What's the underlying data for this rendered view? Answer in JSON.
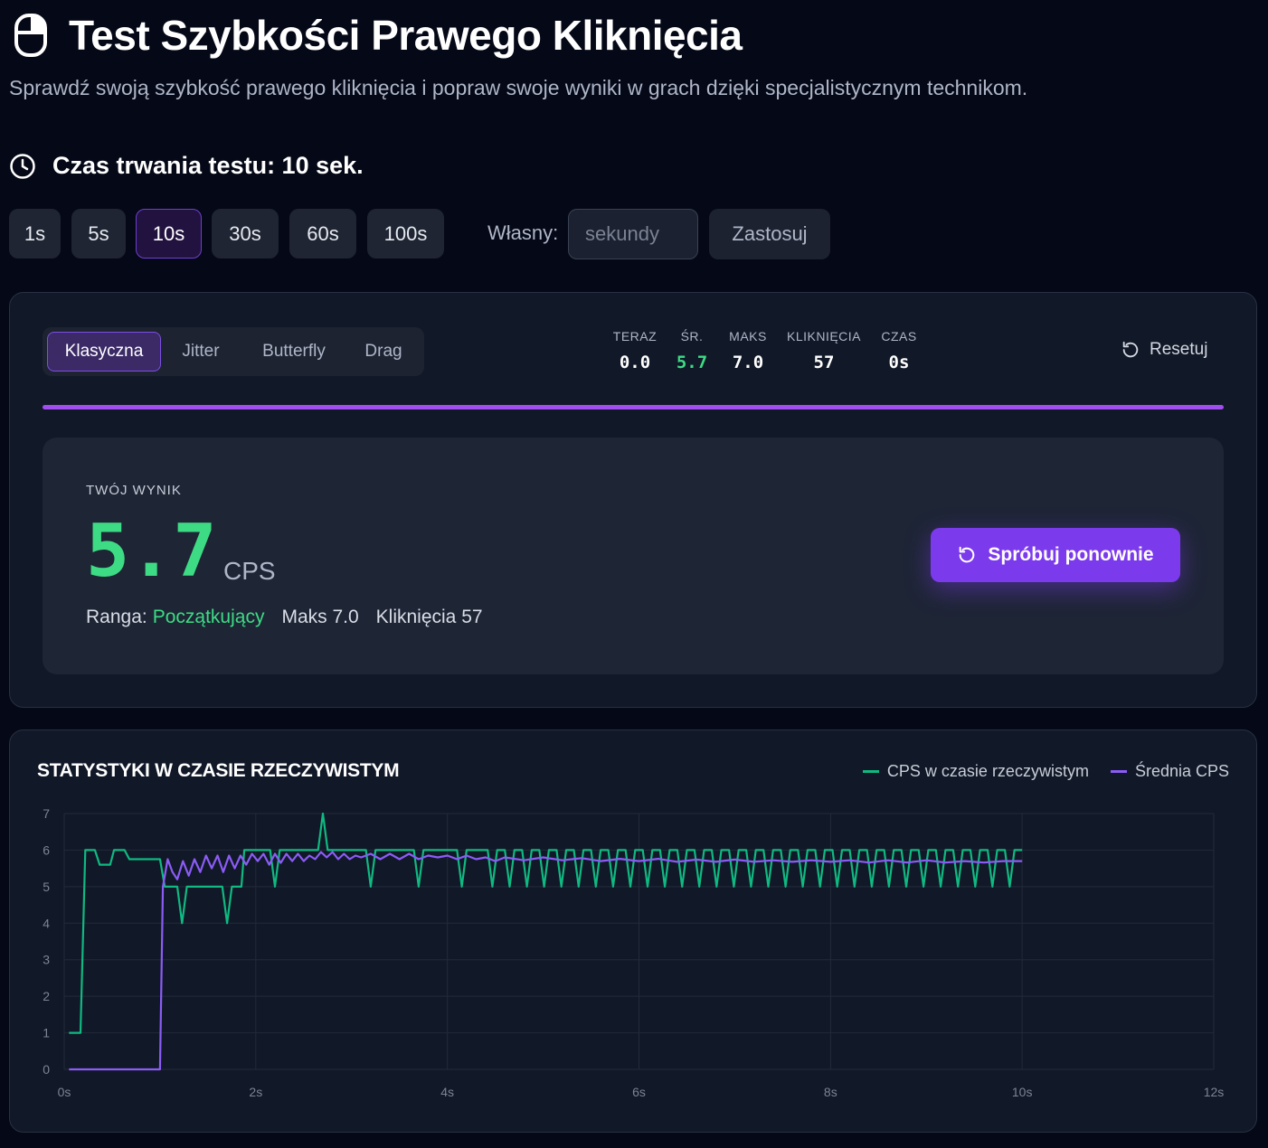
{
  "header": {
    "title": "Test Szybkości Prawego Kliknięcia",
    "subtitle": "Sprawdź swoją szybkość prawego kliknięcia i popraw swoje wyniki w grach dzięki specjalistycznym technikom."
  },
  "duration": {
    "title": "Czas trwania testu: 10 sek.",
    "presets": [
      "1s",
      "5s",
      "10s",
      "30s",
      "60s",
      "100s"
    ],
    "active_preset": "10s",
    "custom_label": "Własny:",
    "custom_placeholder": "sekundy",
    "custom_value": "",
    "apply_label": "Zastosuj"
  },
  "modes": {
    "items": [
      "Klasyczna",
      "Jitter",
      "Butterfly",
      "Drag"
    ],
    "active": "Klasyczna"
  },
  "stats": [
    {
      "label": "TERAZ",
      "value": "0.0"
    },
    {
      "label": "ŚR.",
      "value": "5.7"
    },
    {
      "label": "MAKS",
      "value": "7.0"
    },
    {
      "label": "KLIKNIĘCIA",
      "value": "57"
    },
    {
      "label": "CZAS",
      "value": "0s"
    }
  ],
  "reset_label": "Resetuj",
  "progress_fraction": 1.0,
  "result": {
    "label": "TWÓJ WYNIK",
    "value": "5.7",
    "unit": "CPS",
    "rank_label": "Ranga:",
    "rank_value": "Początkujący",
    "max_text": "Maks 7.0",
    "clicks_text": "Kliknięcia 57",
    "retry_label": "Spróbuj ponownie"
  },
  "colors": {
    "accent": "#7c3aed",
    "green": "#3ddc84",
    "realtime_line": "#10b981",
    "average_line": "#8b5cf6",
    "progress": "#a24df0"
  },
  "chart_data": {
    "type": "line",
    "title": "STATYSTYKI W CZASIE RZECZYWISTYM",
    "xlabel": "",
    "ylabel": "",
    "xlim": [
      0,
      12
    ],
    "ylim": [
      0,
      7
    ],
    "x_ticks": [
      "0s",
      "2s",
      "4s",
      "6s",
      "8s",
      "10s",
      "12s"
    ],
    "y_ticks": [
      "0",
      "1",
      "2",
      "3",
      "4",
      "5",
      "6",
      "7"
    ],
    "grid": true,
    "legend_position": "top-right",
    "series": [
      {
        "name": "CPS w czasie rzeczywistym",
        "color": "#10b981",
        "points": [
          [
            0.05,
            1
          ],
          [
            0.17,
            1
          ],
          [
            0.22,
            6
          ],
          [
            0.32,
            6
          ],
          [
            0.37,
            5.6
          ],
          [
            0.48,
            5.6
          ],
          [
            0.52,
            6
          ],
          [
            0.63,
            6
          ],
          [
            0.68,
            5.75
          ],
          [
            1.0,
            5.75
          ],
          [
            1.05,
            5
          ],
          [
            1.18,
            5
          ],
          [
            1.23,
            4
          ],
          [
            1.28,
            5
          ],
          [
            1.65,
            5
          ],
          [
            1.7,
            4
          ],
          [
            1.75,
            5
          ],
          [
            1.85,
            5
          ],
          [
            1.88,
            6
          ],
          [
            2.15,
            6
          ],
          [
            2.2,
            5
          ],
          [
            2.25,
            6
          ],
          [
            2.65,
            6
          ],
          [
            2.7,
            7
          ],
          [
            2.75,
            6
          ],
          [
            3.15,
            6
          ],
          [
            3.2,
            5
          ],
          [
            3.25,
            6
          ],
          [
            3.65,
            6
          ],
          [
            3.7,
            5
          ],
          [
            3.75,
            6
          ],
          [
            4.1,
            6
          ],
          [
            4.15,
            5
          ],
          [
            4.2,
            6
          ],
          [
            4.42,
            6
          ],
          [
            4.47,
            5
          ],
          [
            4.52,
            6
          ],
          [
            4.6,
            6
          ],
          [
            4.65,
            5
          ],
          [
            4.7,
            6
          ],
          [
            4.78,
            6
          ],
          [
            4.83,
            5
          ],
          [
            4.88,
            6
          ],
          [
            4.96,
            6
          ],
          [
            5.01,
            5
          ],
          [
            5.06,
            6
          ],
          [
            5.14,
            6
          ],
          [
            5.19,
            5
          ],
          [
            5.24,
            6
          ],
          [
            5.32,
            6
          ],
          [
            5.37,
            5
          ],
          [
            5.42,
            6
          ],
          [
            5.5,
            6
          ],
          [
            5.55,
            5
          ],
          [
            5.6,
            6
          ],
          [
            5.68,
            6
          ],
          [
            5.73,
            5
          ],
          [
            5.78,
            6
          ],
          [
            5.86,
            6
          ],
          [
            5.91,
            5
          ],
          [
            5.96,
            6
          ],
          [
            6.04,
            6
          ],
          [
            6.09,
            5
          ],
          [
            6.14,
            6
          ],
          [
            6.22,
            6
          ],
          [
            6.27,
            5
          ],
          [
            6.32,
            6
          ],
          [
            6.4,
            6
          ],
          [
            6.45,
            5
          ],
          [
            6.5,
            6
          ],
          [
            6.58,
            6
          ],
          [
            6.63,
            5
          ],
          [
            6.68,
            6
          ],
          [
            6.76,
            6
          ],
          [
            6.81,
            5
          ],
          [
            6.86,
            6
          ],
          [
            6.94,
            6
          ],
          [
            6.99,
            5
          ],
          [
            7.04,
            6
          ],
          [
            7.12,
            6
          ],
          [
            7.17,
            5
          ],
          [
            7.22,
            6
          ],
          [
            7.3,
            6
          ],
          [
            7.35,
            5
          ],
          [
            7.4,
            6
          ],
          [
            7.48,
            6
          ],
          [
            7.53,
            5
          ],
          [
            7.58,
            6
          ],
          [
            7.66,
            6
          ],
          [
            7.71,
            5
          ],
          [
            7.76,
            6
          ],
          [
            7.84,
            6
          ],
          [
            7.89,
            5
          ],
          [
            7.94,
            6
          ],
          [
            8.02,
            6
          ],
          [
            8.07,
            5
          ],
          [
            8.12,
            6
          ],
          [
            8.2,
            6
          ],
          [
            8.25,
            5
          ],
          [
            8.3,
            6
          ],
          [
            8.38,
            6
          ],
          [
            8.43,
            5
          ],
          [
            8.48,
            6
          ],
          [
            8.56,
            6
          ],
          [
            8.61,
            5
          ],
          [
            8.66,
            6
          ],
          [
            8.74,
            6
          ],
          [
            8.79,
            5
          ],
          [
            8.84,
            6
          ],
          [
            8.92,
            6
          ],
          [
            8.97,
            5
          ],
          [
            9.02,
            6
          ],
          [
            9.1,
            6
          ],
          [
            9.15,
            5
          ],
          [
            9.2,
            6
          ],
          [
            9.28,
            6
          ],
          [
            9.33,
            5
          ],
          [
            9.38,
            6
          ],
          [
            9.46,
            6
          ],
          [
            9.51,
            5
          ],
          [
            9.56,
            6
          ],
          [
            9.64,
            6
          ],
          [
            9.69,
            5
          ],
          [
            9.74,
            6
          ],
          [
            9.82,
            6
          ],
          [
            9.87,
            5
          ],
          [
            9.92,
            6
          ],
          [
            10.0,
            6
          ]
        ]
      },
      {
        "name": "Średnia CPS",
        "color": "#8b5cf6",
        "points": [
          [
            0.05,
            0
          ],
          [
            1.0,
            0
          ],
          [
            1.03,
            5
          ],
          [
            1.08,
            5.75
          ],
          [
            1.13,
            5.4
          ],
          [
            1.18,
            5.2
          ],
          [
            1.24,
            5.7
          ],
          [
            1.3,
            5.3
          ],
          [
            1.36,
            5.75
          ],
          [
            1.42,
            5.4
          ],
          [
            1.48,
            5.85
          ],
          [
            1.54,
            5.5
          ],
          [
            1.6,
            5.85
          ],
          [
            1.66,
            5.4
          ],
          [
            1.72,
            5.85
          ],
          [
            1.78,
            5.5
          ],
          [
            1.84,
            5.85
          ],
          [
            1.9,
            5.6
          ],
          [
            1.96,
            5.9
          ],
          [
            2.02,
            5.7
          ],
          [
            2.08,
            5.9
          ],
          [
            2.14,
            5.6
          ],
          [
            2.2,
            5.9
          ],
          [
            2.26,
            5.65
          ],
          [
            2.32,
            5.9
          ],
          [
            2.38,
            5.7
          ],
          [
            2.44,
            5.9
          ],
          [
            2.5,
            5.7
          ],
          [
            2.56,
            5.85
          ],
          [
            2.62,
            5.75
          ],
          [
            2.68,
            5.95
          ],
          [
            2.74,
            5.8
          ],
          [
            2.8,
            5.95
          ],
          [
            2.86,
            5.75
          ],
          [
            2.92,
            5.9
          ],
          [
            2.98,
            5.75
          ],
          [
            3.04,
            5.85
          ],
          [
            3.1,
            5.8
          ],
          [
            3.2,
            5.9
          ],
          [
            3.3,
            5.75
          ],
          [
            3.4,
            5.9
          ],
          [
            3.5,
            5.75
          ],
          [
            3.6,
            5.9
          ],
          [
            3.7,
            5.75
          ],
          [
            3.8,
            5.85
          ],
          [
            3.9,
            5.8
          ],
          [
            4.0,
            5.85
          ],
          [
            4.1,
            5.75
          ],
          [
            4.2,
            5.85
          ],
          [
            4.3,
            5.75
          ],
          [
            4.4,
            5.8
          ],
          [
            4.5,
            5.7
          ],
          [
            4.6,
            5.8
          ],
          [
            4.8,
            5.72
          ],
          [
            5.0,
            5.8
          ],
          [
            5.2,
            5.72
          ],
          [
            5.4,
            5.78
          ],
          [
            5.6,
            5.7
          ],
          [
            5.8,
            5.76
          ],
          [
            6.0,
            5.7
          ],
          [
            6.2,
            5.76
          ],
          [
            6.4,
            5.68
          ],
          [
            6.6,
            5.74
          ],
          [
            6.8,
            5.68
          ],
          [
            7.0,
            5.74
          ],
          [
            7.2,
            5.68
          ],
          [
            7.4,
            5.72
          ],
          [
            7.6,
            5.68
          ],
          [
            7.8,
            5.72
          ],
          [
            8.0,
            5.68
          ],
          [
            8.2,
            5.72
          ],
          [
            8.4,
            5.66
          ],
          [
            8.6,
            5.72
          ],
          [
            8.8,
            5.66
          ],
          [
            9.0,
            5.72
          ],
          [
            9.2,
            5.66
          ],
          [
            9.4,
            5.7
          ],
          [
            9.6,
            5.66
          ],
          [
            9.8,
            5.7
          ],
          [
            10.0,
            5.7
          ]
        ]
      }
    ]
  }
}
